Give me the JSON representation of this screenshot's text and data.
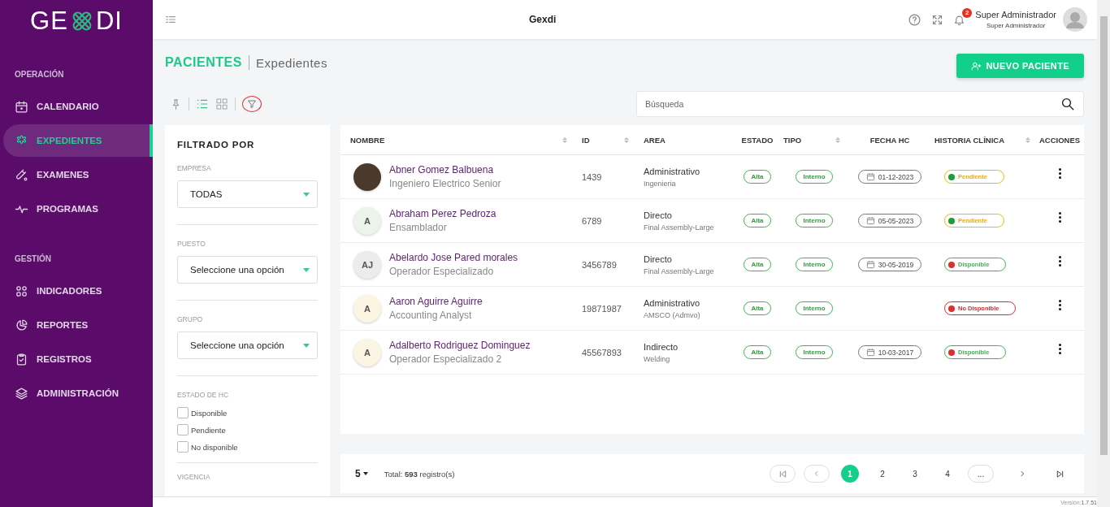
{
  "sidebar": {
    "logo": {
      "left": "GE",
      "right": "DI"
    },
    "sections": [
      {
        "title": "OPERACIÓN",
        "items": [
          {
            "label": "CALENDARIO",
            "selected": false
          },
          {
            "label": "EXPEDIENTES",
            "selected": true
          },
          {
            "label": "EXAMENES",
            "selected": false
          },
          {
            "label": "PROGRAMAS",
            "selected": false
          }
        ]
      },
      {
        "title": "GESTIÓN",
        "items": [
          {
            "label": "INDICADORES",
            "selected": false
          },
          {
            "label": "REPORTES",
            "selected": false
          },
          {
            "label": "REGISTROS",
            "selected": false
          },
          {
            "label": "ADMINISTRACIÓN",
            "selected": false
          }
        ]
      }
    ]
  },
  "header": {
    "title": "Gexdi",
    "notifications": "2",
    "user_name": "Super Administrador",
    "user_role": "Super Administrador"
  },
  "page": {
    "title": "PACIENTES",
    "subtitle": "Expedientes",
    "new_button": "NUEVO PACIENTE"
  },
  "toolbar": {
    "views": [
      {
        "selected": true
      },
      {
        "selected": false
      }
    ]
  },
  "search": {
    "placeholder": "Búsqueda"
  },
  "filters": {
    "title": "FILTRADO POR",
    "selects": [
      {
        "label": "EMPRESA",
        "value": "TODAS"
      },
      {
        "label": "PUESTO",
        "value": "Seleccione una opción"
      },
      {
        "label": "GRUPO",
        "value": "Seleccione una opción"
      }
    ],
    "hc_state": {
      "label": "ESTADO DE HC",
      "options": [
        {
          "label": "Disponible",
          "checked": false
        },
        {
          "label": "Pendiente",
          "checked": false
        },
        {
          "label": "No disponible",
          "checked": false
        }
      ]
    },
    "vigencia": {
      "label": "VIGENCIA"
    }
  },
  "table": {
    "columns": [
      {
        "label": "NOMBRE",
        "sortable": true
      },
      {
        "label": "ID",
        "sortable": true
      },
      {
        "label": "AREA",
        "sortable": false
      },
      {
        "label": "ESTADO",
        "sortable": false
      },
      {
        "label": "TIPO",
        "sortable": true
      },
      {
        "label": "FECHA HC",
        "sortable": false
      },
      {
        "label": "HISTORIA CLÍNICA",
        "sortable": true
      },
      {
        "label": "ACCIONES",
        "sortable": false
      }
    ],
    "rows": [
      {
        "avatar": {
          "kind": "photo"
        },
        "name": "Abner Gomez Balbuena",
        "position": "Ingeniero Electrico Senior",
        "id": "1439",
        "area": "Administrativo",
        "subarea": "Ingenieria",
        "estado": "Alta",
        "tipo": "Interno",
        "fecha": "01-12-2023",
        "hc": {
          "label": "Pendiente",
          "kind": "pending",
          "color": "#1e9e3a"
        }
      },
      {
        "avatar": {
          "kind": "initials",
          "initials": "A",
          "color": "#eaf4e9"
        },
        "name": "Abraham Perez Pedroza",
        "position": "Ensamblador",
        "id": "6789",
        "area": "Directo",
        "subarea": "Final Assembly-Large",
        "estado": "Alta",
        "tipo": "Interno",
        "fecha": "05-05-2023",
        "hc": {
          "label": "Pendiente",
          "kind": "pending",
          "color": "#1e9e3a"
        }
      },
      {
        "avatar": {
          "kind": "initials",
          "initials": "AJ",
          "color": "#ececec"
        },
        "name": "Abelardo Jose Pared morales",
        "position": "Operador Especializado",
        "id": "3456789",
        "area": "Directo",
        "subarea": "Final Assembly-Large",
        "estado": "Alta",
        "tipo": "Interno",
        "fecha": "30-05-2019",
        "hc": {
          "label": "Disponible",
          "kind": "available",
          "color": "#d93030"
        }
      },
      {
        "avatar": {
          "kind": "initials",
          "initials": "A",
          "color": "#fcf5e3"
        },
        "name": "Aaron Aguirre Aguirre",
        "position": "Accounting Analyst",
        "id": "19871987",
        "area": "Administrativo",
        "subarea": "AMSCO (Admvo)",
        "estado": "Alta",
        "tipo": "Interno",
        "hc": {
          "label": "No Disponible",
          "kind": "unavailable",
          "color": "#d93030"
        }
      },
      {
        "avatar": {
          "kind": "initials",
          "initials": "A",
          "color": "#fcf5e3"
        },
        "name": "Adalberto Rodriguez Dominguez",
        "position": "Operador Especializado 2",
        "id": "45567893",
        "area": "Indirecto",
        "subarea": "Welding",
        "estado": "Alta",
        "tipo": "Interno",
        "fecha": "10-03-2017",
        "hc": {
          "label": "Disponible",
          "kind": "available",
          "color": "#d93030"
        }
      }
    ]
  },
  "pagination": {
    "page_size": "5",
    "total_label": "Total:",
    "total": "593",
    "total_suffix": "registro(s)",
    "pages": [
      {
        "label": "1",
        "selected": true
      },
      {
        "label": "2",
        "selected": false
      },
      {
        "label": "3",
        "selected": false
      },
      {
        "label": "4",
        "selected": false
      }
    ],
    "more": "..."
  },
  "footer": {
    "version_label": "Versión:",
    "version": "1.7.51"
  }
}
